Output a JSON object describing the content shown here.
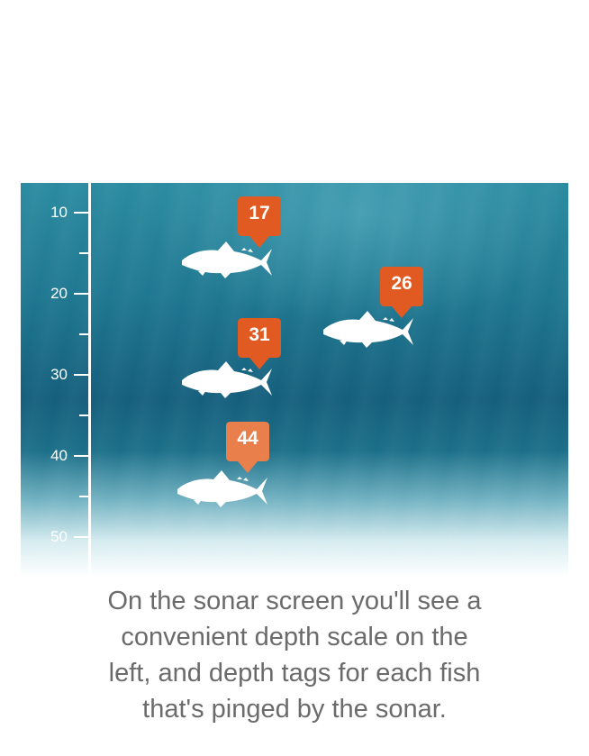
{
  "depth_scale": {
    "labels": [
      "10",
      "20",
      "30",
      "40",
      "50"
    ]
  },
  "depth_tags": [
    {
      "value": "17",
      "color": "#e05a22"
    },
    {
      "value": "26",
      "color": "#e05a22"
    },
    {
      "value": "31",
      "color": "#e05a22"
    },
    {
      "value": "44",
      "color": "#e9804c"
    }
  ],
  "caption": {
    "line1": "On the sonar screen you'll see a",
    "line2": "convenient depth scale on the",
    "line3": "left, and depth tags for each fish",
    "line4": "that's pinged by the sonar."
  },
  "colors": {
    "water_top": "#2b8ba1",
    "water_deep": "#155f7d",
    "caption_text": "#6b6b6b",
    "fish": "#ffffff"
  }
}
